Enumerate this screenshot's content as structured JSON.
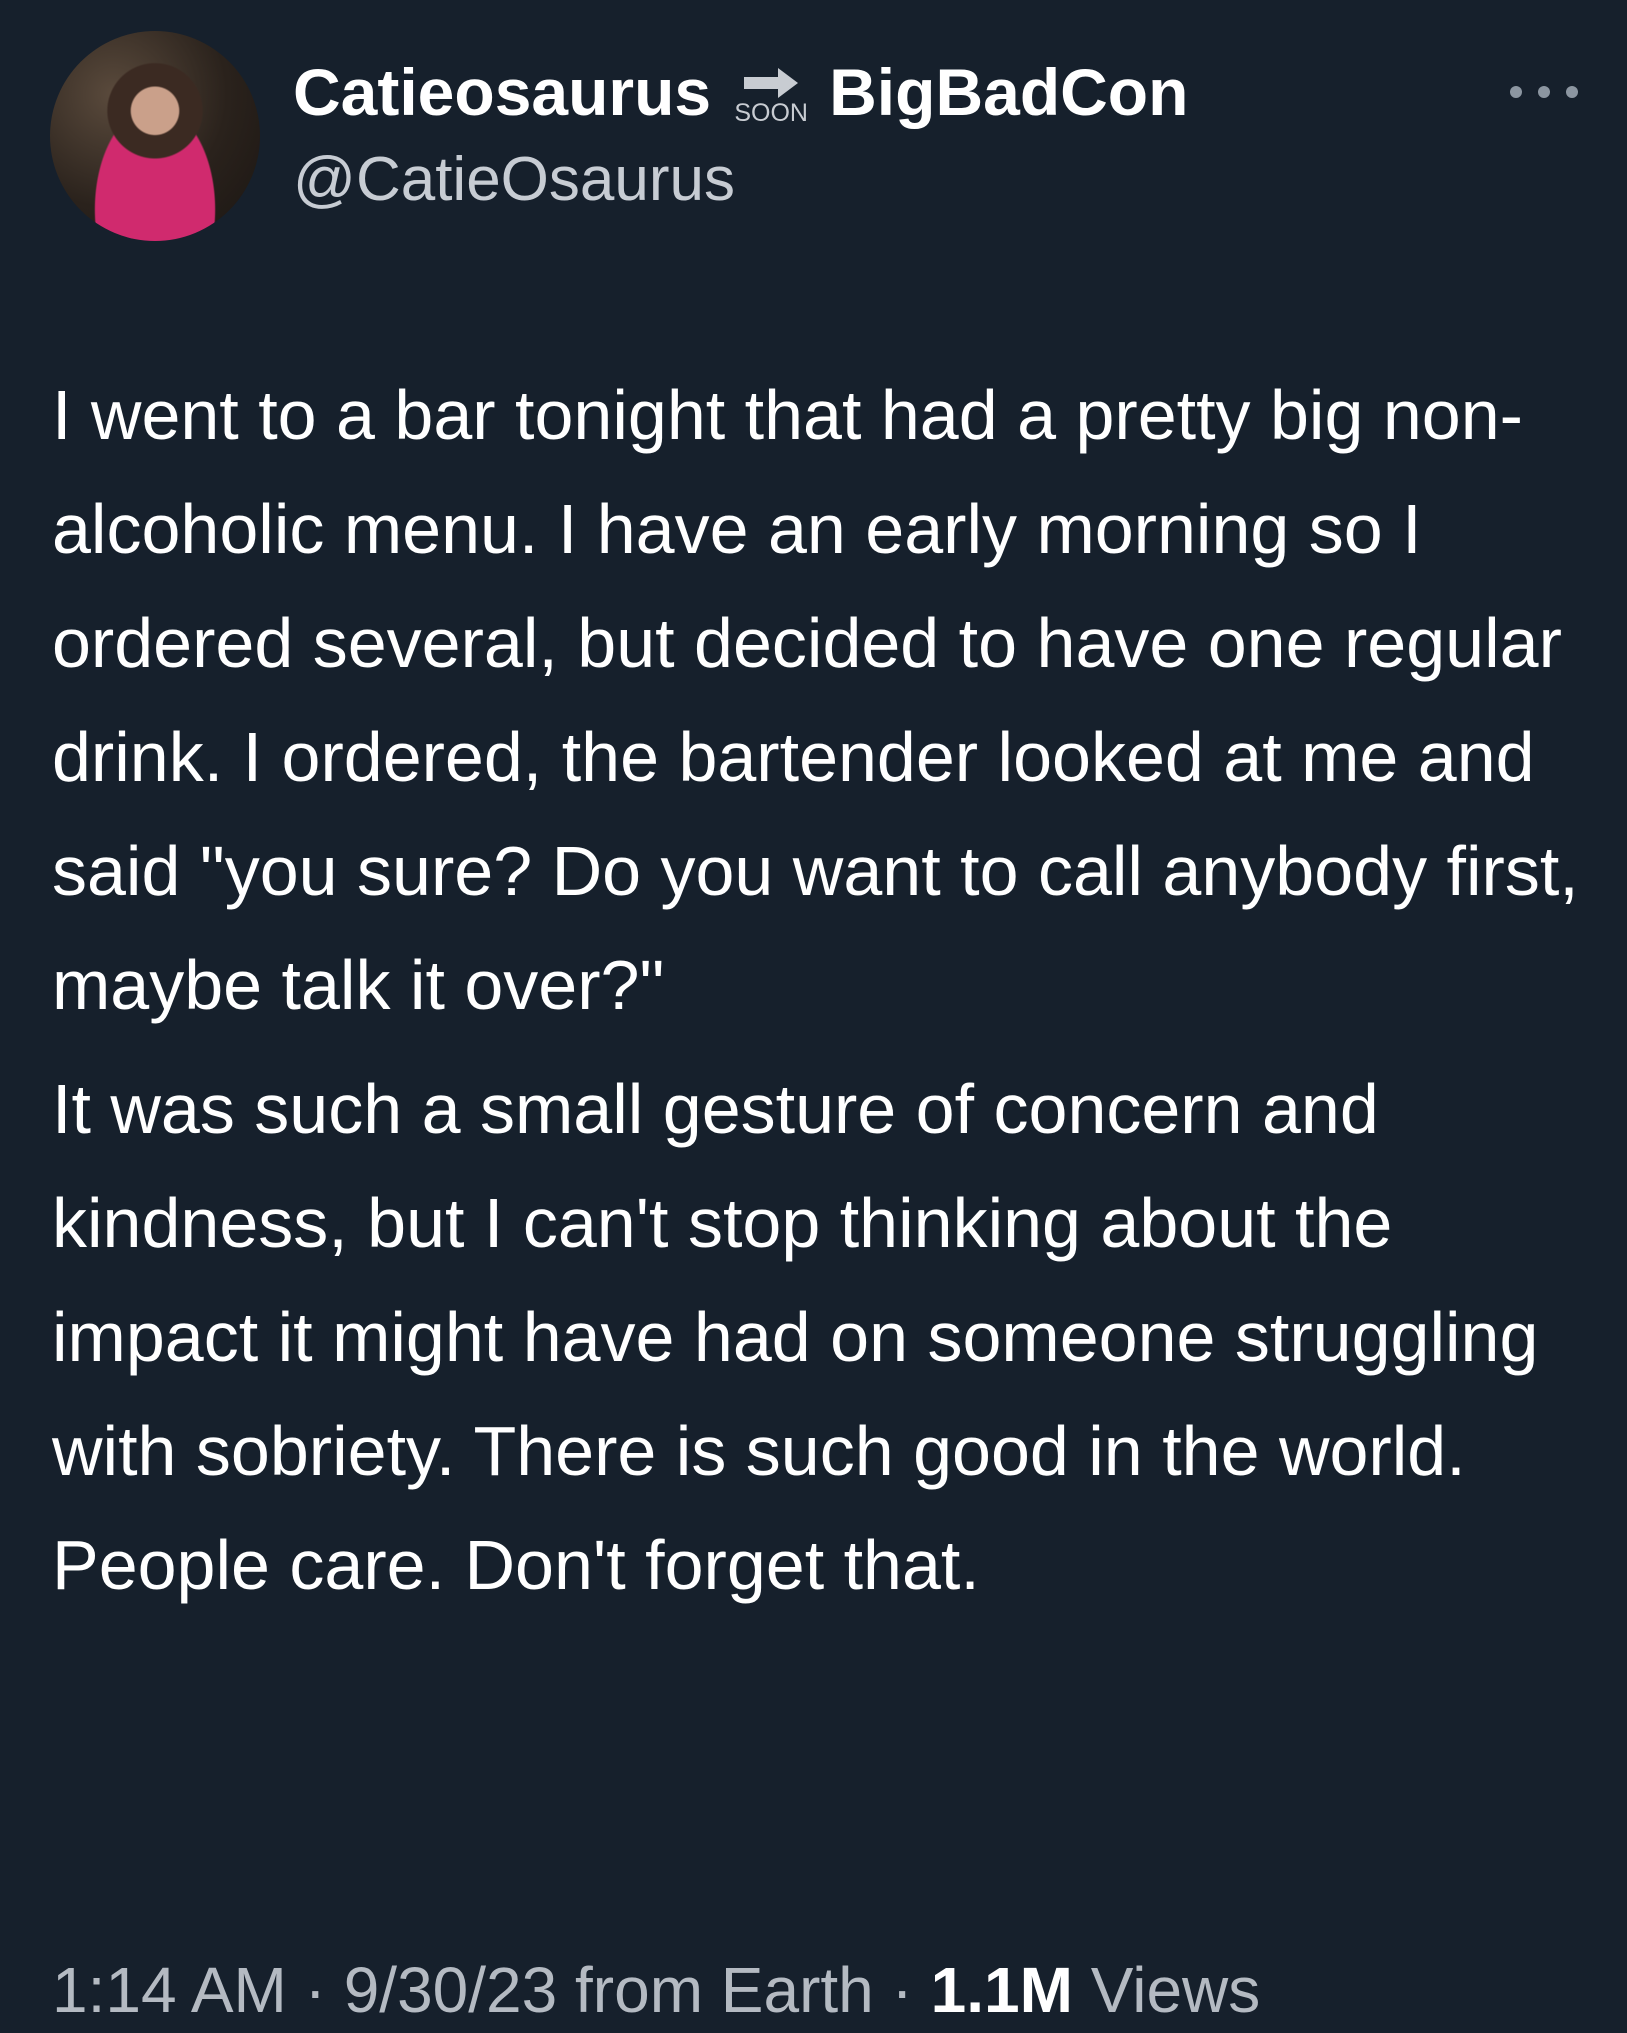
{
  "tweet": {
    "display_name": "Catieosaurus",
    "badge_text": "SOON",
    "display_name_suffix": "BigBadCon",
    "handle": "@CatieOsaurus",
    "paragraphs": [
      "I went to a bar tonight that had a pretty big non-alcoholic menu. I have an early morning so I ordered several, but decided to have one regular drink. I ordered, the bartender looked at me and said \"you sure? Do you want to call anybody first, maybe talk it over?\"",
      "It was such a small gesture of concern and kindness, but I can't stop thinking about the impact it might have had on someone struggling with sobriety. There is such good in the world. People care. Don't forget that."
    ],
    "time": "1:14 AM",
    "separator": "·",
    "date_source": "9/30/23 from Earth",
    "views_count": "1.1M",
    "views_label": "Views"
  },
  "colors": {
    "background": "#16202c",
    "text": "#ffffff",
    "muted": "#b4bac2"
  },
  "icons": {
    "more": "more-options-icon",
    "badge": "soon-arrow-icon"
  }
}
